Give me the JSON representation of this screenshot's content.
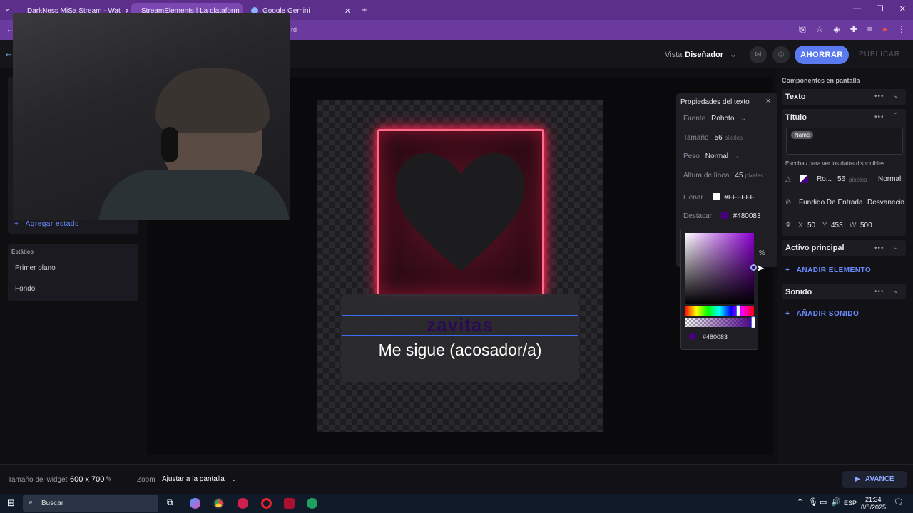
{
  "browser": {
    "tabs": [
      {
        "label": "DarkNess MiSa Stream - Wat",
        "active": false
      },
      {
        "label": "StreamElements | La plataform",
        "active": true
      },
      {
        "label": "Google Gemini",
        "active": false
      }
    ],
    "address_suffix": "rd"
  },
  "header": {
    "vista_label": "Vista",
    "vista_value": "Diseñador",
    "save_label": "AHORRAR",
    "publish_label": "PUBLICAR"
  },
  "left_panel": {
    "add_state_label": "Agregar estado",
    "static_title": "Estático",
    "items": [
      "Primer plano",
      "Fondo"
    ]
  },
  "canvas": {
    "name_text": "zavitas",
    "subtitle": "Me sigue (acosador/a)"
  },
  "text_props": {
    "title": "Propiedades del texto",
    "font_label": "Fuente",
    "font_value": "Roboto",
    "size_label": "Tamaño",
    "size_value": "56",
    "size_unit": "píxeles",
    "weight_label": "Peso",
    "weight_value": "Normal",
    "line_height_label": "Altura de línea",
    "line_height_value": "45",
    "line_height_unit": "píxeles",
    "fill_label": "Llenar",
    "fill_value": "#FFFFFF",
    "highlight_label": "Destacar",
    "highlight_value": "#480083",
    "percent_symbol": "%"
  },
  "picker": {
    "hex_value": "#480083"
  },
  "right_panel": {
    "title": "Componentes en pantalla",
    "texto_label": "Texto",
    "titulo_label": "Título",
    "name_chip": "Name",
    "hint": "Escriba / para ver los datos disponibles",
    "font_short": "Ro...",
    "font_size": "56",
    "font_unit": "píxeles",
    "font_weight": "Normal",
    "anim_in": "Fundido De Entrada",
    "anim_out": "Desvanecimi",
    "x_label": "X",
    "x_value": "50",
    "y_label": "Y",
    "y_value": "453",
    "w_label": "W",
    "w_value": "500",
    "activo_label": "Activo principal",
    "add_element": "AÑADIR ELEMENTO",
    "sonido_label": "Sonido",
    "add_sound": "AÑADIR SONIDO"
  },
  "bottom": {
    "widget_size_label": "Tamaño del widget",
    "widget_size_value": "600 x 700",
    "zoom_label": "Zoom",
    "zoom_value": "Ajustar a la pantalla",
    "advance_label": "AVANCE"
  },
  "taskbar": {
    "search_placeholder": "Buscar",
    "lang": "ESP",
    "time": "21:34",
    "date": "8/8/2025"
  },
  "colors": {
    "accent": "#5a7bf0",
    "browser_frame": "#5b2f8a",
    "neon": "#ff2d55",
    "highlight": "#480083"
  }
}
